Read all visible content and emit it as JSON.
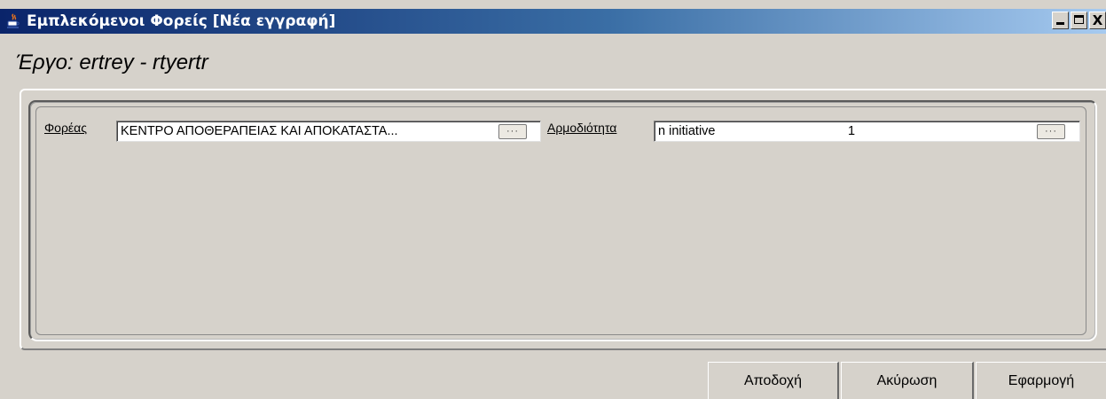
{
  "window": {
    "title": "Εμπλεκόμενοι Φορείς [Νέα εγγραφή]",
    "controls": {
      "minimize": "minimize",
      "maximize": "maximize",
      "close": "X"
    }
  },
  "project": {
    "heading": "Έργο: ertrey - rtyertr"
  },
  "form": {
    "agency": {
      "label": "Φορέας",
      "value": "ΚΕΝΤΡΟ ΑΠΟΘΕΡΑΠΕΙΑΣ ΚΑΙ ΑΠΟΚΑΤΑΣΤΑ...",
      "browse_label": "···"
    },
    "competence": {
      "label": "Αρμοδιότητα",
      "value_name": "n initiative",
      "value_code": "1",
      "browse_label": "···"
    }
  },
  "buttons": {
    "accept": "Αποδοχή",
    "cancel": "Ακύρωση",
    "apply": "Εφαρμογή"
  },
  "icons": {
    "title_icon": "java-coffee-cup-icon"
  }
}
